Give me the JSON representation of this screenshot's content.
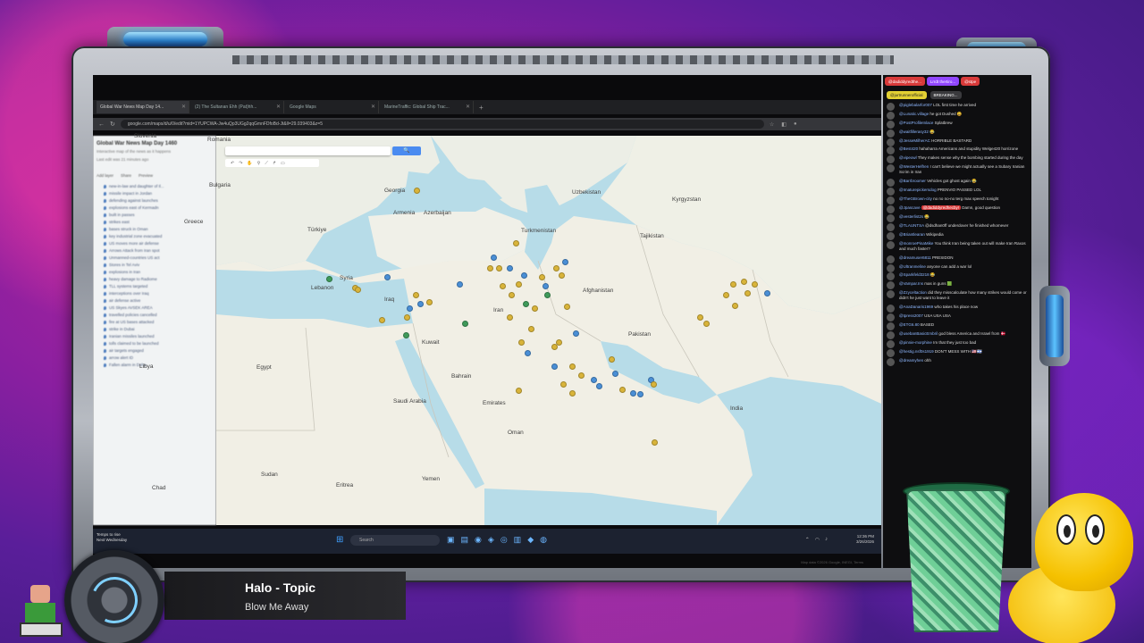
{
  "browser": {
    "tabs": [
      {
        "label": "Global War News Map Day 14...",
        "active": true
      },
      {
        "label": "(2) The Sultanan Ehh (Pat)hh...",
        "active": false
      },
      {
        "label": "Google Maps",
        "active": false
      },
      {
        "label": "MarineTraffic: Global Ship Trac...",
        "active": false
      }
    ],
    "url": "google.com/maps/d/u/0/edit?mid=1YUPCWA-Jw4uQp3UGg2qqGmnFDfoBd-Jt&ll=29.039403&z=5"
  },
  "mymaps": {
    "title": "Global War News Map Day 1460",
    "subtitle": "Interactive map of the news as it happens",
    "last_edit": "Last edit was 21 minutes ago",
    "actions": [
      "Add layer",
      "Share",
      "Preview"
    ],
    "layers": [
      "new-in-law and daughter of Il...",
      "missile impact in Jordan",
      "defending against launches",
      "explosions east of Kermadn",
      "built in passes",
      "strikes east",
      "bases struck in Oman",
      "key industrial zone evacuated",
      "US moves more air defense",
      "Arrows Attack from Iran spot",
      "Unmanned-countries US act",
      "Stores in Tel Aviv",
      "explosions in Iran",
      "heavy damage to Radiome",
      "TLL systems targeted",
      "interceptions over Iraq",
      "air defense active",
      "US Skyes AVSEK AREA",
      "travelled policies cancelled",
      "fire at US bases attacked",
      "strike in Dubai",
      "Iranian missiles launched",
      "tolls claimed to be launched",
      "air targets engaged",
      "arrow alert ID",
      "Fallen alarm in Doha"
    ],
    "search_button": "🔍"
  },
  "map": {
    "labels": {
      "slovenia": "Slovenia",
      "romania": "Romania",
      "bulgaria": "Bulgaria",
      "greece": "Greece",
      "turkiye": "Türkiye",
      "georgia": "Georgia",
      "armenia": "Armenia",
      "azerbaijan": "Azerbaijan",
      "uzbekistan": "Uzbekistan",
      "kyrgyzstan": "Kyrgyzstan",
      "turkmenistan": "Turkmenistan",
      "tajikistan": "Tajikistan",
      "syria": "Syria",
      "iraq": "Iraq",
      "iran": "Iran",
      "afghanistan": "Afghanistan",
      "pakistan": "Pakistan",
      "libya": "Libya",
      "egypt": "Egypt",
      "saudi": "Saudi Arabia",
      "oman": "Oman",
      "emirates": "Emirates",
      "yemen": "Yemen",
      "sudan": "Sudan",
      "eritrea": "Eritrea",
      "chad": "Chad",
      "india": "India",
      "lebanon": "Lebanon",
      "kuwait": "Kuwait",
      "bahrain": "Bahrain"
    },
    "credit": "Map data ©2026 Google, INEGI, Terms",
    "pin_colors": {
      "yellow": "#d9b43a",
      "blue": "#4a8fd6",
      "green": "#3f9a5a"
    }
  },
  "taskbar": {
    "weather": "Temps to rise",
    "weather_sub": "Next Wednesday",
    "search_placeholder": "Search",
    "time": "12:36 PM",
    "date": "3/26/2026"
  },
  "chat": {
    "tabs": [
      "@dadiddyredthe...",
      "Lrrdt thertiro...",
      "@stpe"
    ],
    "pinned_user": "@jurtrunnerofficial",
    "pinned_label": "BREAKING...",
    "messages": [
      {
        "user": "@piglebalarfor007",
        "text": "LOL first time he arrived"
      },
      {
        "user": "@Lunatic.village",
        "text": "he got Dushed 😀"
      },
      {
        "user": "@PostProfileInlace",
        "text": "Splatbrew"
      },
      {
        "user": "@waitfillerasy32",
        "text": "😂"
      },
      {
        "user": "@JesseMilherAC",
        "text": "HORRIBLE BASTARD"
      },
      {
        "user": "@Best420",
        "text": "hahaharra Americans and stupidity Welge420 horrizone"
      },
      {
        "user": "@vipeowl",
        "text": "They makes sense why the bombing started during the day"
      },
      {
        "user": "@WesterHelfren",
        "text": "I can't believe we might actually see a Subary Iranian Scrim in Iran"
      },
      {
        "user": "@Barrbroomer",
        "text": "Vehicles got ghost again 😂"
      },
      {
        "user": "@Imaturepickersdog",
        "text": "PRENVIO PASSED LOL"
      },
      {
        "user": "@TheGBrown-city",
        "text": "no no no-no terg max speech tonight"
      },
      {
        "user": "@Jpascave",
        "text": "Damn, good question",
        "mention": "@dadiddyredhecby!"
      },
      {
        "user": "@vesterlist2s",
        "text": "😂"
      },
      {
        "user": "@TLAUNTSA",
        "text": "@dsdhan0ff underdover he finished whomever"
      },
      {
        "user": "@Briantlearan",
        "text": "Wikipedia"
      },
      {
        "user": "@monroePinaMike",
        "text": "You think Iran being taken out will make Iran Raxos and much faster?"
      },
      {
        "user": "@dreamuser6811",
        "text": "PRESIDON"
      },
      {
        "user": "@Ultranmeline",
        "text": "anyone can add a war lol"
      },
      {
        "user": "@Sparkfeld3218",
        "text": "😂"
      },
      {
        "user": "@Vampar.Ins",
        "text": "mas in guns 🟩"
      },
      {
        "user": "@Zzyceltaction",
        "text": "did they misscalculate how many strikes would come or didn't he just want to leave it"
      },
      {
        "user": "@AnaDanaris1969",
        "text": "who takes his place now"
      },
      {
        "user": "@tpress2007",
        "text": "USA USA USA"
      },
      {
        "user": "@ETG6.80",
        "text": "BASED"
      },
      {
        "user": "@usebanBasicEmbril",
        "text": "god bless America and Israel from 🇩🇰"
      },
      {
        "user": "@pinnie-morphine",
        "text": "Im that they just too bad"
      },
      {
        "user": "@hestig.nsf0s1919",
        "text": "DON'T MESS WITH 🇺🇸🇮🇱"
      },
      {
        "user": "@dreamyhen",
        "text": "ohh"
      }
    ]
  },
  "now_playing": {
    "title": "Halo - Topic",
    "song": "Blow Me Away"
  }
}
